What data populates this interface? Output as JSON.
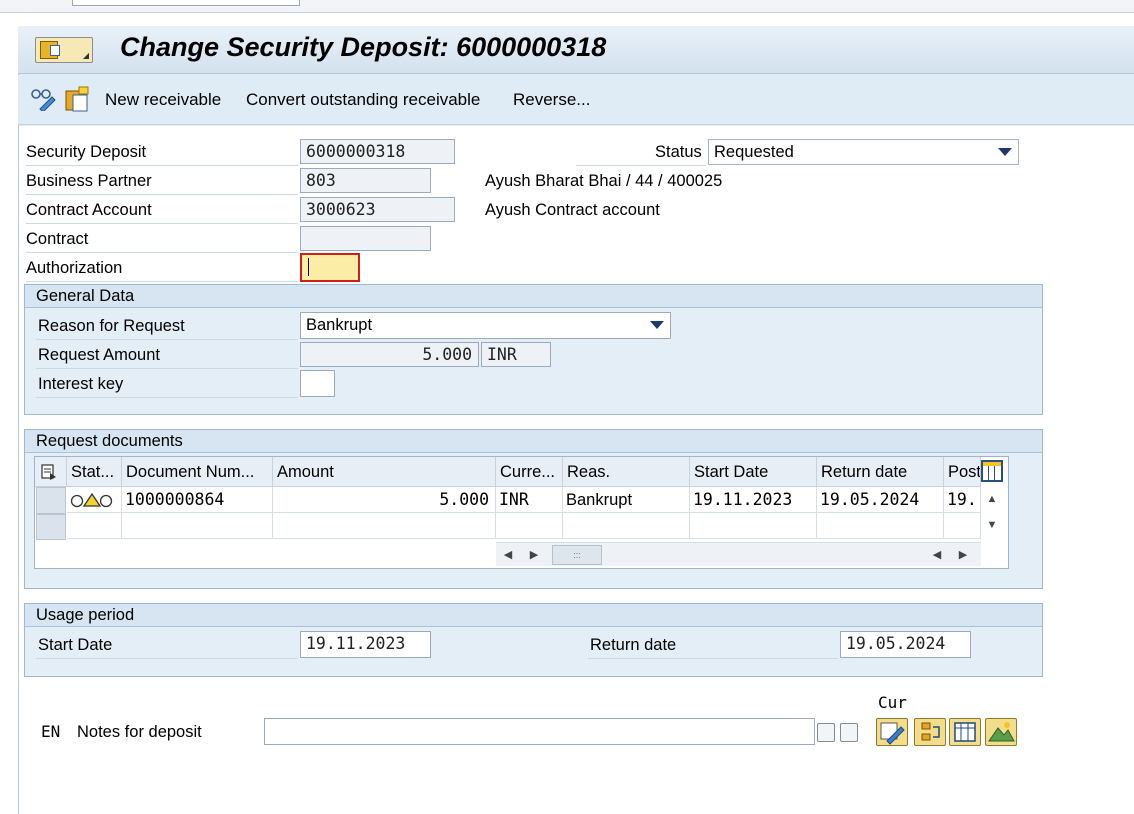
{
  "window": {
    "title": "Change Security Deposit: 6000000318"
  },
  "toolbar": {
    "new_receivable": "New receivable",
    "convert_outstanding": "Convert outstanding receivable",
    "reverse": "Reverse..."
  },
  "header": {
    "security_deposit_label": "Security Deposit",
    "security_deposit_value": "6000000318",
    "status_label": "Status",
    "status_value": "Requested",
    "business_partner_label": "Business Partner",
    "business_partner_value": "803",
    "business_partner_desc": "Ayush Bharat Bhai / 44 / 400025",
    "contract_account_label": "Contract Account",
    "contract_account_value": "3000623",
    "contract_account_desc": "Ayush Contract account",
    "contract_label": "Contract",
    "contract_value": "",
    "authorization_label": "Authorization",
    "authorization_value": ""
  },
  "general_data": {
    "title": "General Data",
    "reason_label": "Reason for Request",
    "reason_value": "Bankrupt",
    "amount_label": "Request Amount",
    "amount_value": "5.000",
    "currency_value": "INR",
    "interest_key_label": "Interest key",
    "interest_key_value": ""
  },
  "request_documents": {
    "title": "Request documents",
    "columns": [
      "Stat...",
      "Document Num...",
      "Amount",
      "Curre...",
      "Reas.",
      "Start Date",
      "Return date",
      "Post"
    ],
    "rows": [
      {
        "status": "",
        "document_number": "1000000864",
        "amount": "5.000",
        "currency": "INR",
        "reason": "Bankrupt",
        "start_date": "19.11.2023",
        "return_date": "19.05.2024",
        "post": "19."
      }
    ]
  },
  "usage_period": {
    "title": "Usage period",
    "start_label": "Start Date",
    "start_value": "19.11.2023",
    "return_label": "Return date",
    "return_value": "19.05.2024"
  },
  "notes": {
    "lang": "EN",
    "label": "Notes for deposit",
    "value": "",
    "cur_label": "Cur"
  },
  "colors": {
    "window_bg": "#dfebf5",
    "group_bg": "#e3eef7",
    "required_border": "#d21c1c",
    "required_fill": "#fbeda5"
  }
}
